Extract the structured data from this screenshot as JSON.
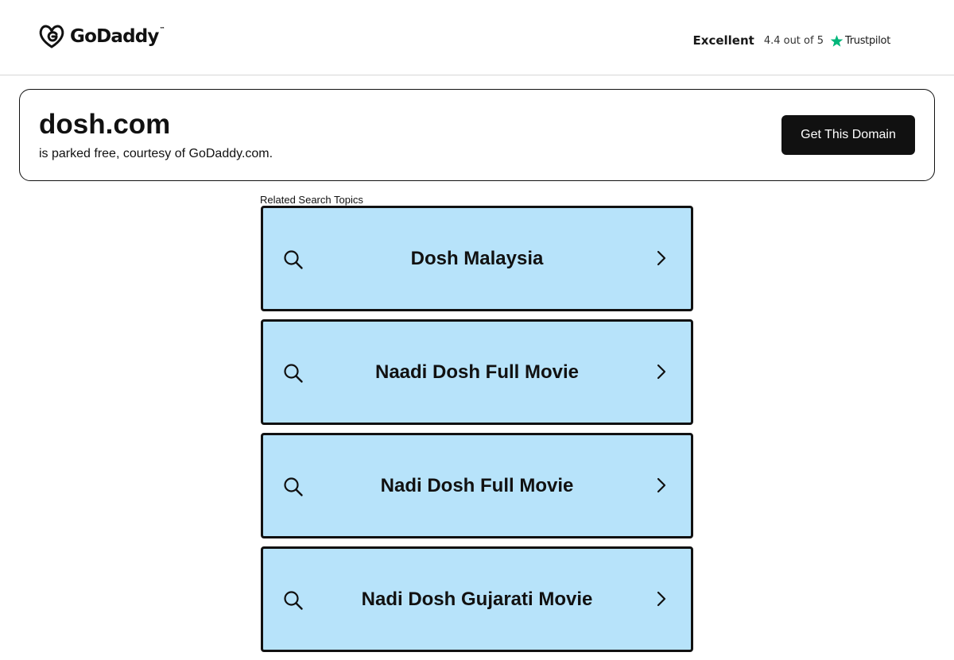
{
  "header": {
    "logo_text": "GoDaddy",
    "logo_icon": "godaddy-logo-icon",
    "rating_word": "Excellent",
    "rating_score": "4.4 out of 5",
    "rating_source": "Trustpilot",
    "rating_icon": "trustpilot-star-icon",
    "trustpilot_color": "#00b67a"
  },
  "domain_card": {
    "domain": "dosh.com",
    "subtitle": "is parked free, courtesy of GoDaddy.com.",
    "button_label": "Get This Domain"
  },
  "related": {
    "label": "Related Search Topics",
    "background_color": "#b7e3fa",
    "items": [
      {
        "label": "Dosh Malaysia",
        "icon": "search-icon",
        "arrow": "chevron-right-icon"
      },
      {
        "label": "Naadi Dosh Full Movie",
        "icon": "search-icon",
        "arrow": "chevron-right-icon"
      },
      {
        "label": "Nadi Dosh Full Movie",
        "icon": "search-icon",
        "arrow": "chevron-right-icon"
      },
      {
        "label": "Nadi Dosh Gujarati Movie",
        "icon": "search-icon",
        "arrow": "chevron-right-icon"
      }
    ]
  }
}
